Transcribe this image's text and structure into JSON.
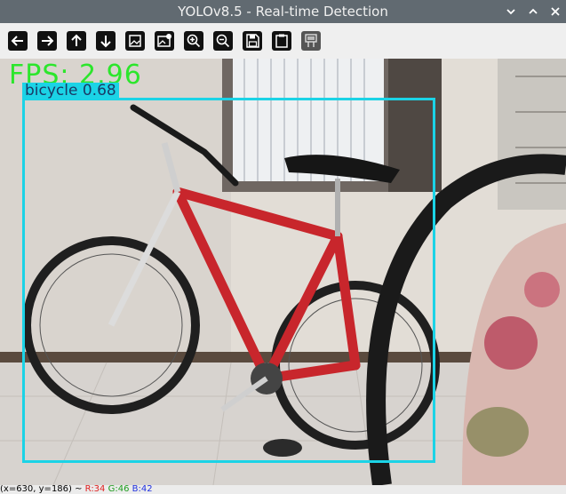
{
  "window": {
    "title": "YOLOv8.5 - Real-time Detection",
    "controls": [
      "chevron-down-icon",
      "chevron-up-icon",
      "close-icon"
    ]
  },
  "toolbar": {
    "buttons": [
      {
        "icon": "arrow-left-icon"
      },
      {
        "icon": "arrow-right-icon"
      },
      {
        "icon": "arrow-up-icon"
      },
      {
        "icon": "arrow-down-icon"
      },
      {
        "icon": "image-icon"
      },
      {
        "icon": "image-settings-icon"
      },
      {
        "icon": "zoom-in-icon"
      },
      {
        "icon": "zoom-out-icon"
      },
      {
        "icon": "save-icon"
      },
      {
        "icon": "clipboard-icon"
      },
      {
        "icon": "properties-icon"
      }
    ]
  },
  "overlay": {
    "fps_text": "FPS: 2.96",
    "detection": {
      "label": "bicycle 0.68",
      "box_color": "#1bd3e6",
      "fps_color": "#2ce62c"
    }
  },
  "status": {
    "coords": "(x=630, y=186) ~ ",
    "r": "R:34",
    "g": "G:46",
    "b": "B:42",
    "colors": {
      "r": "#e02020",
      "g": "#1c9c1c",
      "b": "#2030e0"
    }
  }
}
